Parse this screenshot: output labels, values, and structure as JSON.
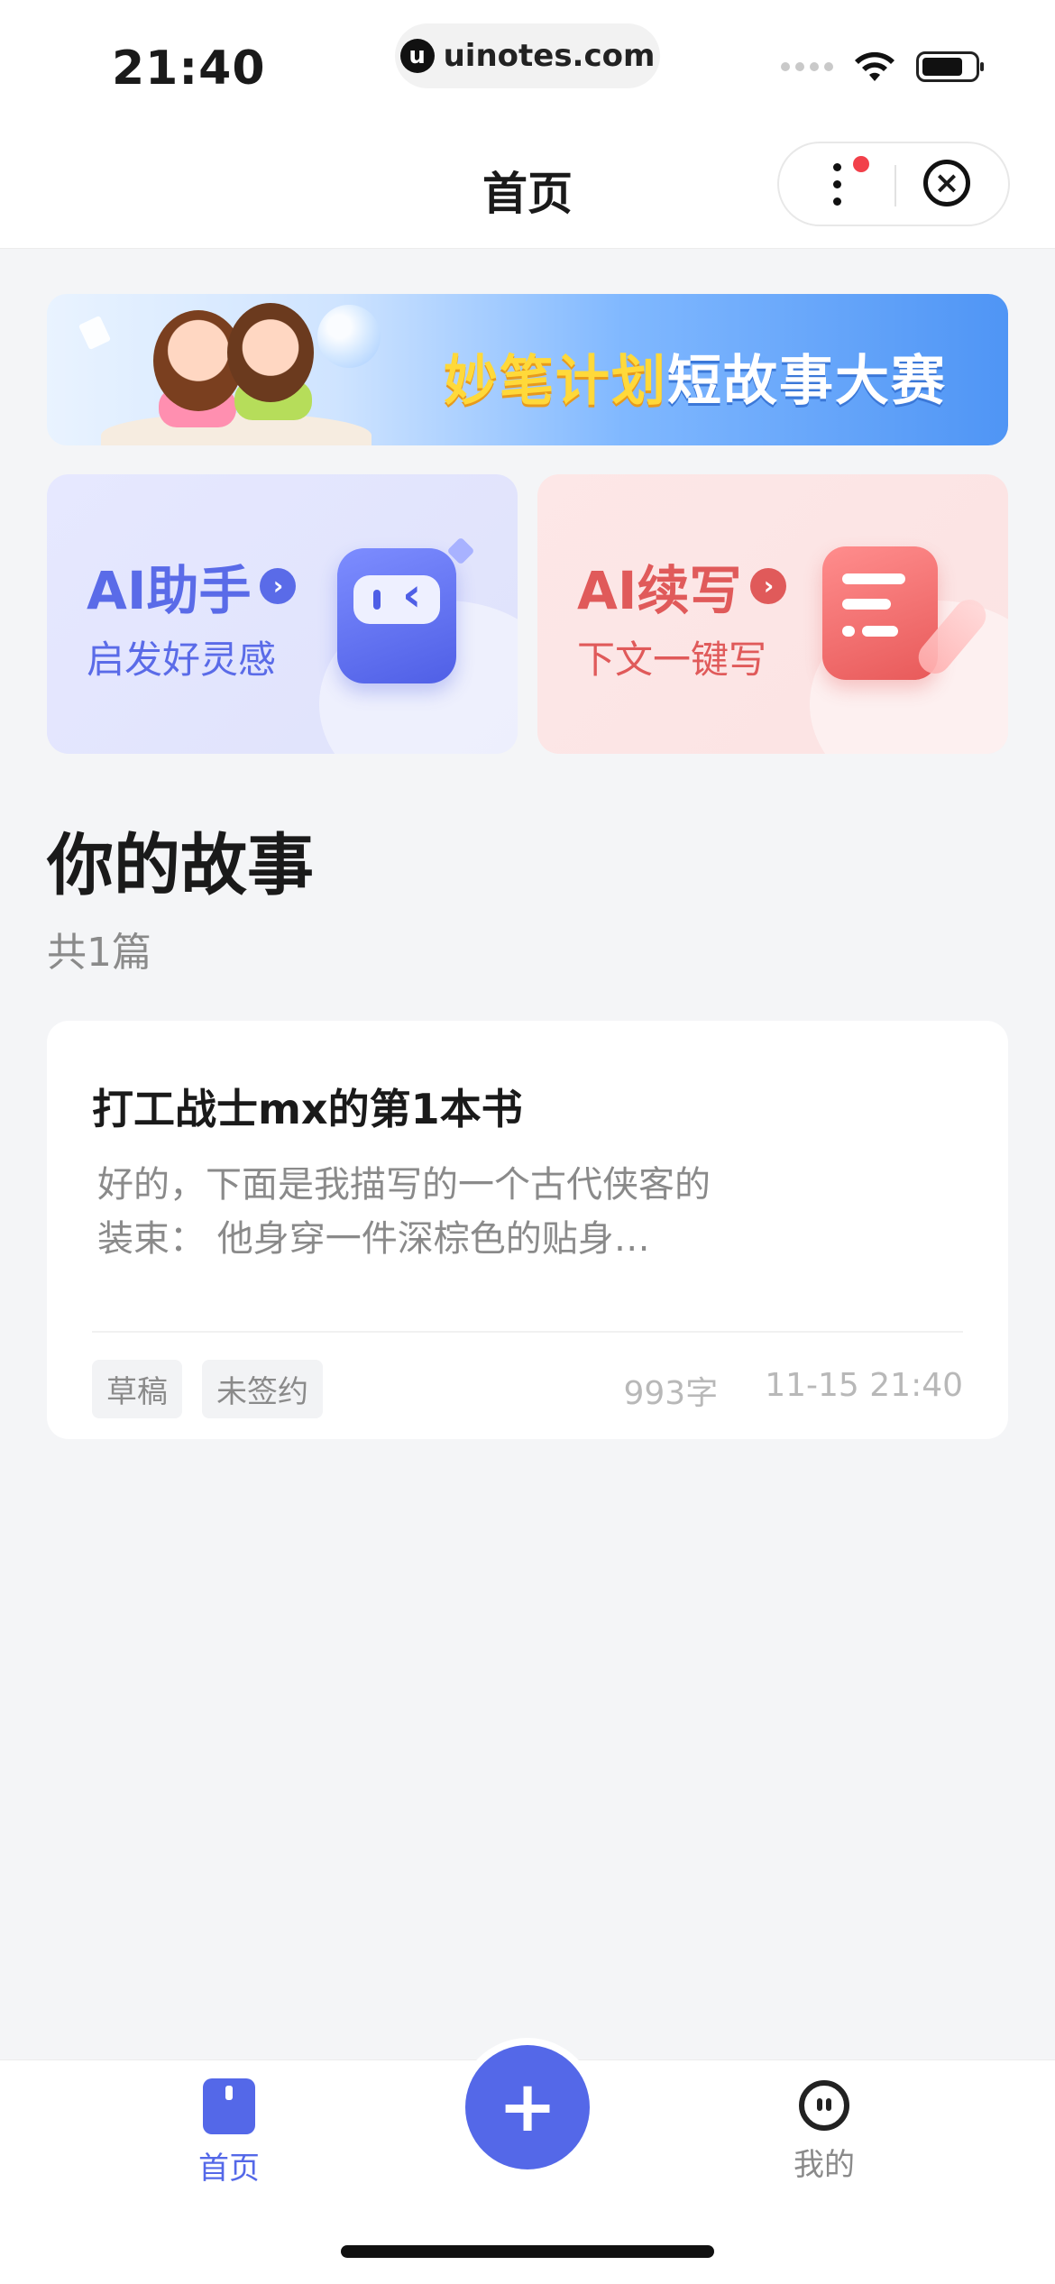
{
  "status_bar": {
    "time": "21:40",
    "url": "uinotes.com"
  },
  "nav": {
    "title": "首页"
  },
  "banner": {
    "text_yellow": "妙笔计划",
    "text_white": "短故事大赛"
  },
  "features": [
    {
      "title": "AI助手",
      "subtitle": "启发好灵感"
    },
    {
      "title": "AI续写",
      "subtitle": "下文一键写"
    }
  ],
  "stories_section": {
    "title": "你的故事",
    "count": "共1篇"
  },
  "stories": [
    {
      "title": "打工战士mx的第1本书",
      "excerpt": "好的，下面是我描写的一个古代侠客的装束： 他身穿一件深棕色的贴身…",
      "tags": [
        "草稿",
        "未签约"
      ],
      "word_count": "993字",
      "time": "11-15 21:40"
    }
  ],
  "tabbar": {
    "home": "首页",
    "add": "+",
    "mine": "我的"
  },
  "colors": {
    "accent": "#5468e8",
    "ai_card": "#5a6be8",
    "write_card": "#e05a5a"
  }
}
